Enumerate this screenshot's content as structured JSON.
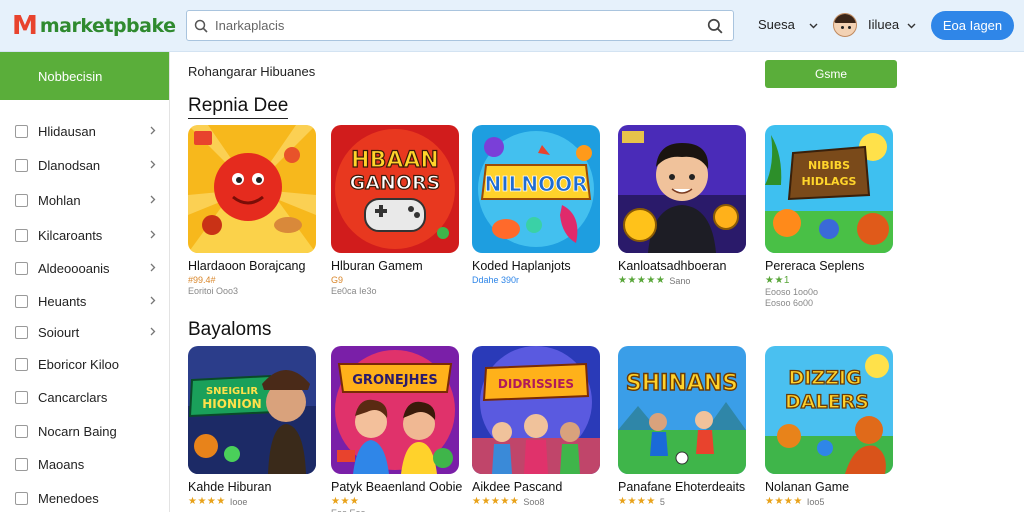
{
  "header": {
    "logo_m": "M",
    "logo_text": "marketpbake",
    "search_placeholder": "Inarkaplacis",
    "dropdown_label": "Suesa",
    "user_label": "Iiluea",
    "login_label": "Eoa Iagen"
  },
  "sidebar": {
    "header": "Nobbecisin",
    "items": [
      {
        "label": "Hlidausan",
        "chevron": true
      },
      {
        "label": "Dlanodsan",
        "chevron": true
      },
      {
        "label": "Mohlan",
        "chevron": true
      },
      {
        "label": "Kilcaroants",
        "chevron": true
      },
      {
        "label": "Aldeoooanis",
        "chevron": true
      },
      {
        "label": "Heuants",
        "chevron": true
      },
      {
        "label": "Soiourt",
        "chevron": true
      },
      {
        "label": "Eboricor Kiloo",
        "chevron": false
      },
      {
        "label": "Cancarclars",
        "chevron": false
      },
      {
        "label": "Nocarn Baing",
        "chevron": false
      },
      {
        "label": "Maoans",
        "chevron": false
      },
      {
        "label": "Menedoes",
        "chevron": false
      }
    ]
  },
  "main": {
    "breadcrumb": "Rohangarar Hibuanes",
    "game_button": "Gsme",
    "section1_title": "Repnia Dee",
    "section2_title": "Bayaloms",
    "row1": [
      {
        "title": "Hlardaoon Borajcang",
        "meta1": "#99.4#",
        "meta2": "Eoritoi Ooo3",
        "stars": "",
        "meta1_style": "orange"
      },
      {
        "title": "Hlburan Gamem",
        "meta1": "G9",
        "meta2": "Ee0ca Ie3o",
        "stars": "",
        "meta1_style": "orange"
      },
      {
        "title": "Koded Haplanjots",
        "meta1": "Ddahe 390r",
        "meta2": "",
        "stars": "",
        "meta1_style": "blue"
      },
      {
        "title": "Kanloatsadhboeran",
        "meta1": "Sano",
        "meta2": "",
        "stars": "★★★★★",
        "meta1_style": "gray"
      },
      {
        "title": "Pereraca Seplens",
        "meta1": "",
        "meta2": "Eooso 1oo0o",
        "meta3": "Eosoo 6o00",
        "stars": "★★1",
        "meta1_style": "gray"
      }
    ],
    "row2": [
      {
        "title": "Kahde Hiburan",
        "meta1": "Iooe",
        "stars": "★★★★"
      },
      {
        "title": "Patyk Beaenland Oobie",
        "meta1": "",
        "stars": "★★★",
        "meta2": "Eoo Eoo"
      },
      {
        "title": "Aikdee Pascand",
        "meta1": "Soo8",
        "stars": "★★★★★"
      },
      {
        "title": "Panafane Ehoterdeaits",
        "meta1": "5",
        "stars": "★★★★"
      },
      {
        "title": "Nolanan Game",
        "meta1": "Ioo5",
        "stars": "★★★★"
      }
    ],
    "thumb_art_text": [
      "",
      "HBAAN GANORS",
      "NILNOOR",
      "",
      "NIBIBS HIDLAGS",
      "SNEIGLIR HIONION",
      "GRONEJHES",
      "DIDRISSIES",
      "SHINANS",
      "DIZZIG DALERS"
    ]
  },
  "colors": {
    "accent_green": "#5aae3a",
    "accent_blue": "#2f86e8",
    "header_bg": "#e6f1fb",
    "logo_red": "#e8432d"
  }
}
